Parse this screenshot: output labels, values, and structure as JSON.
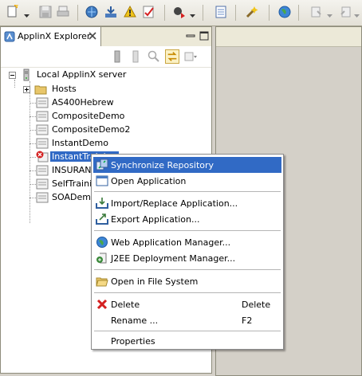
{
  "view": {
    "tab_title": "ApplinX Explorer"
  },
  "tree": {
    "root": "Local ApplinX server",
    "items": [
      {
        "label": "Hosts",
        "kind": "folder"
      },
      {
        "label": "AS400Hebrew",
        "kind": "app"
      },
      {
        "label": "CompositeDemo",
        "kind": "app"
      },
      {
        "label": "CompositeDemo2",
        "kind": "app"
      },
      {
        "label": "InstantDemo",
        "kind": "app"
      },
      {
        "label": "InstantTraining",
        "kind": "app-error"
      },
      {
        "label": "INSURANCE",
        "kind": "app"
      },
      {
        "label": "SelfTraining",
        "kind": "app"
      },
      {
        "label": "SOADemo",
        "kind": "app"
      }
    ]
  },
  "context_menu": {
    "items": [
      {
        "label": "Synchronize Repository",
        "icon": "sync-repository-icon",
        "highlighted": true
      },
      {
        "label": "Open Application",
        "icon": "open-application-icon"
      },
      {
        "label": "Import/Replace Application...",
        "icon": "import-icon"
      },
      {
        "label": "Export Application...",
        "icon": "export-icon"
      },
      {
        "label": "Web Application Manager...",
        "icon": "web-app-manager-icon"
      },
      {
        "label": "J2EE Deployment Manager...",
        "icon": "j2ee-deployment-icon"
      },
      {
        "label": "Open in File System",
        "icon": "open-folder-icon"
      },
      {
        "label": "Delete",
        "icon": "delete-icon",
        "accelerator": "Delete"
      },
      {
        "label": "Rename ...",
        "accelerator": "F2"
      },
      {
        "label": "Properties"
      }
    ]
  },
  "colors": {
    "selection": "#316ac5",
    "delete_red": "#d42020"
  }
}
